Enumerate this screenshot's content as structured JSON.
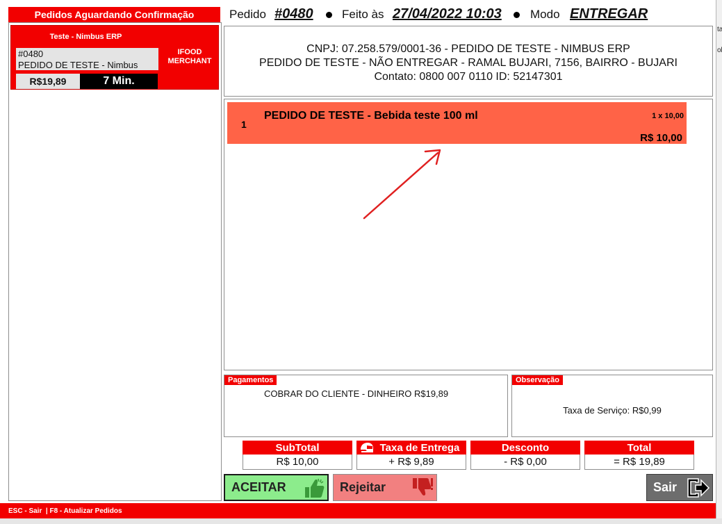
{
  "background_window": {
    "fragments": [
      "ta",
      "ol"
    ]
  },
  "left": {
    "title": "Pedidos Aguardando Confirmação",
    "card": {
      "company": "Teste - Nimbus ERP",
      "order_number": "#0480",
      "description": "PEDIDO DE TESTE - Nimbus",
      "price": "R$19,89",
      "time": "7 Min.",
      "origin_line1": "IFOOD",
      "origin_line2": "MERCHANT"
    }
  },
  "header": {
    "pedido_label": "Pedido",
    "pedido_value": "#0480",
    "feito_label": "Feito às",
    "feito_value": "27/04/2022 10:03",
    "modo_label": "Modo",
    "modo_value": "ENTREGAR"
  },
  "info": {
    "line1": "CNPJ: 07.258.579/0001-36 - PEDIDO DE TESTE - NIMBUS ERP",
    "line2": "PEDIDO DE TESTE - NÃO ENTREGAR - RAMAL BUJARI, 7156, BAIRRO - BUJARI",
    "line3": "Contato: 0800 007 0110 ID: 52147301"
  },
  "items": [
    {
      "index": "1",
      "name": "PEDIDO DE TESTE - Bebida teste 100 ml",
      "qty": "1 x 10,00",
      "price": "R$ 10,00"
    }
  ],
  "payments": {
    "title": "Pagamentos",
    "text": "COBRAR DO CLIENTE - DINHEIRO R$19,89"
  },
  "observation": {
    "title": "Observação",
    "text": "Taxa de Serviço: R$0,99"
  },
  "totals": {
    "subtotal_label": "SubTotal",
    "subtotal_value": "R$ 10,00",
    "delivery_label": "Taxa de Entrega",
    "delivery_value": "+ R$ 9,89",
    "discount_label": "Desconto",
    "discount_value": "- R$ 0,00",
    "total_label": "Total",
    "total_value": "= R$ 19,89"
  },
  "buttons": {
    "accept": "ACEITAR",
    "reject": "Rejeitar",
    "exit": "Sair"
  },
  "statusbar": {
    "text": "ESC - Sair  | F8 - Atualizar Pedidos"
  },
  "colors": {
    "red": "#f20000",
    "item_row": "#ff6347",
    "accept": "#8cec8c",
    "reject": "#f28080",
    "exit": "#6d6d6d"
  }
}
